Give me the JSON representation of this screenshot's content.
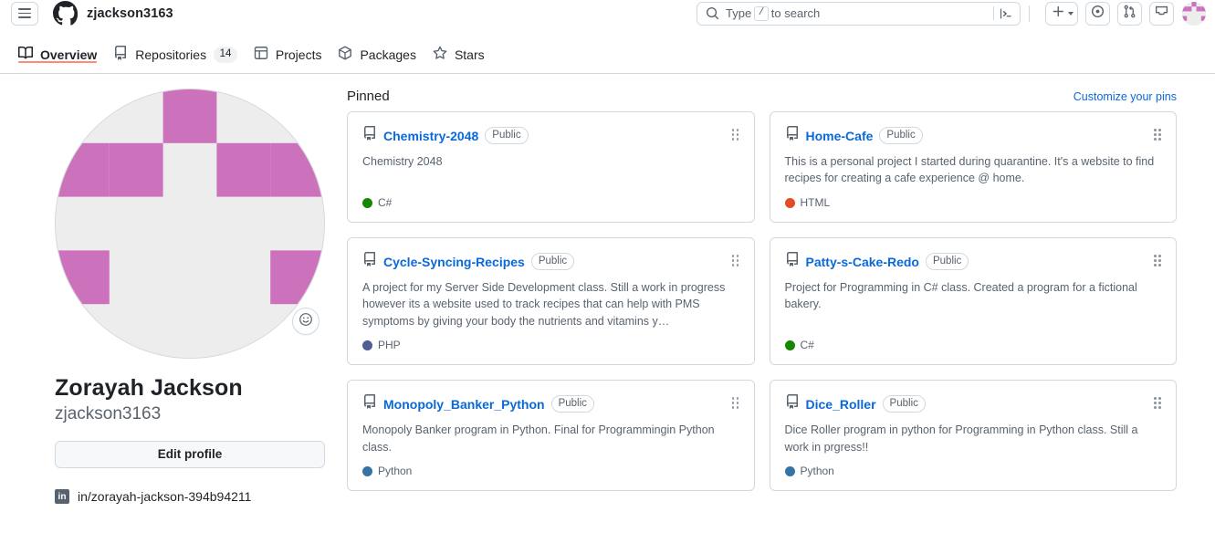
{
  "header": {
    "hamburger_label": "Open global navigation menu",
    "logo_icon": "github-mark-icon",
    "owner": "zjackson3163",
    "search": {
      "placeholder_before": "Type",
      "placeholder_key": "/",
      "placeholder_after": "to search",
      "icon": "search-icon",
      "terminal_icon": "command-palette-terminal-icon"
    },
    "actions": [
      {
        "name": "create-new-button",
        "icon": "plus-icon",
        "has_caret": true
      },
      {
        "name": "issues-button",
        "icon": "issue-opened-icon",
        "has_caret": false
      },
      {
        "name": "pull-requests-button",
        "icon": "git-pull-request-icon",
        "has_caret": false
      },
      {
        "name": "notifications-button",
        "icon": "inbox-icon",
        "has_caret": false
      }
    ],
    "avatar_alt": "zjackson3163 avatar"
  },
  "nav": {
    "tabs": [
      {
        "label": "Overview",
        "icon": "book-icon",
        "active": true,
        "badge": null
      },
      {
        "label": "Repositories",
        "icon": "repo-icon",
        "active": false,
        "badge": "14"
      },
      {
        "label": "Projects",
        "icon": "table-icon",
        "active": false,
        "badge": null
      },
      {
        "label": "Packages",
        "icon": "package-icon",
        "active": false,
        "badge": null
      },
      {
        "label": "Stars",
        "icon": "star-icon",
        "active": false,
        "badge": null
      }
    ],
    "active_underline_color": "#fd8c73"
  },
  "profile": {
    "avatar": {
      "background": "#ededed",
      "tile_color": "#cc72bd",
      "pattern": [
        [
          0,
          0,
          1,
          0,
          0
        ],
        [
          1,
          1,
          0,
          1,
          1
        ],
        [
          0,
          0,
          0,
          0,
          0
        ],
        [
          1,
          0,
          0,
          0,
          1
        ],
        [
          0,
          0,
          0,
          0,
          0
        ]
      ]
    },
    "status_button": {
      "icon": "smiley-icon",
      "label": "Set status"
    },
    "full_name": "Zorayah Jackson",
    "login": "zjackson3163",
    "edit_profile_label": "Edit profile",
    "social": [
      {
        "icon": "linkedin-icon",
        "badge_text": "in",
        "text": "in/zorayah-jackson-394b94211"
      }
    ]
  },
  "pinned": {
    "title": "Pinned",
    "customize_label": "Customize your pins",
    "repos": [
      {
        "name": "Chemistry-2048",
        "visibility": "Public",
        "description": "Chemistry 2048",
        "language": "C#",
        "language_color": "#178600",
        "icon": "repo-icon",
        "drag_icon": "grabber-icon"
      },
      {
        "name": "Home-Cafe",
        "visibility": "Public",
        "description": "This is a personal project I started during quarantine. It's a website to find recipes for creating a cafe experience @ home.",
        "language": "HTML",
        "language_color": "#e34c26",
        "icon": "repo-icon",
        "drag_icon": "grabber-icon"
      },
      {
        "name": "Cycle-Syncing-Recipes",
        "visibility": "Public",
        "description": "A project for my Server Side Development class. Still a work in progress however its a website used to track recipes that can help with PMS symptoms by giving your body the nutrients and vitamins y…",
        "language": "PHP",
        "language_color": "#4F5D95",
        "icon": "repo-icon",
        "drag_icon": "grabber-icon"
      },
      {
        "name": "Patty-s-Cake-Redo",
        "visibility": "Public",
        "description": "Project for Programming in C# class. Created a program for a fictional bakery.",
        "language": "C#",
        "language_color": "#178600",
        "icon": "repo-icon",
        "drag_icon": "grabber-icon"
      },
      {
        "name": "Monopoly_Banker_Python",
        "visibility": "Public",
        "description": "Monopoly Banker program in Python. Final for Programmingin Python class.",
        "language": "Python",
        "language_color": "#3572A5",
        "icon": "repo-icon",
        "drag_icon": "grabber-icon"
      },
      {
        "name": "Dice_Roller",
        "visibility": "Public",
        "description": "Dice Roller program in python for Programming in Python class. Still a work in prgress!!",
        "language": "Python",
        "language_color": "#3572A5",
        "icon": "repo-icon",
        "drag_icon": "grabber-icon"
      }
    ]
  },
  "colors": {
    "link": "#0969da",
    "border": "#d1d9e0",
    "muted_text": "#59636e",
    "accent_underline": "#fd8c73",
    "button_bg": "#f6f8fa"
  }
}
